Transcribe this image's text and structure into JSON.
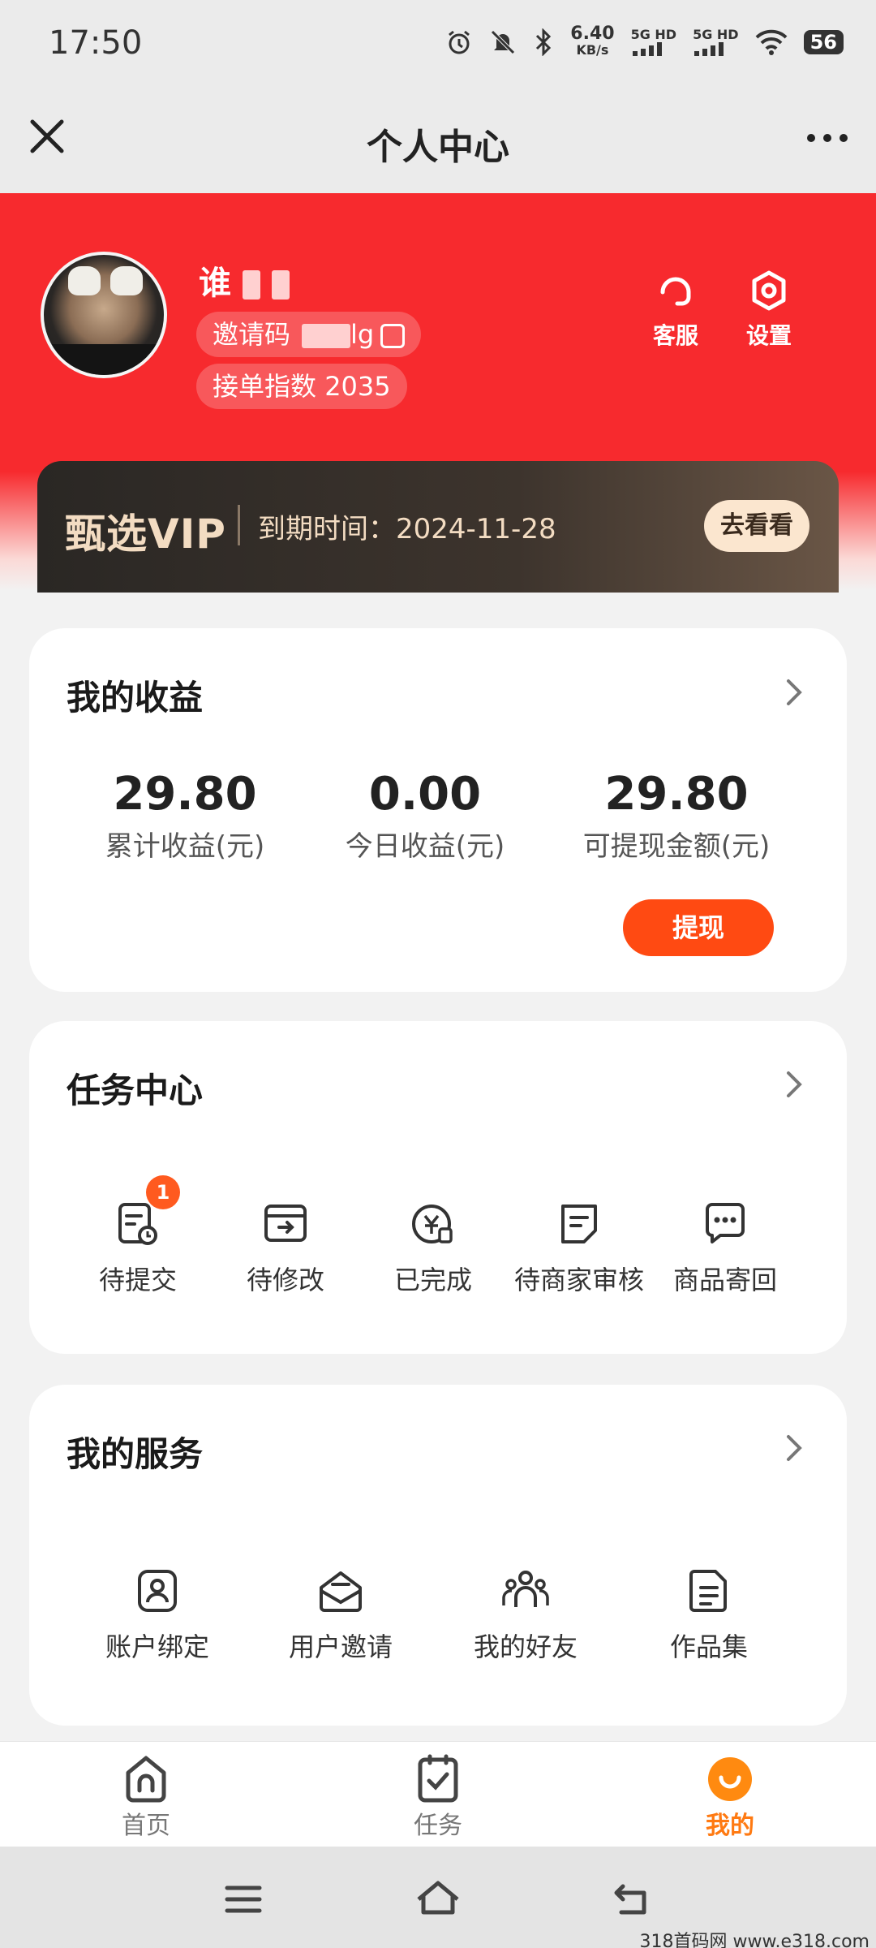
{
  "status_bar": {
    "time": "17:50",
    "net_speed_value": "6.40",
    "net_speed_unit": "KB/s",
    "sim1": "5G HD",
    "sim2": "5G HD",
    "battery": "56"
  },
  "header": {
    "title": "个人中心"
  },
  "profile": {
    "name": "谁",
    "invite_label": "邀请码",
    "invite_tail": "lg",
    "score_label": "接单指数",
    "score_value": "2035",
    "customer_service_label": "客服",
    "settings_label": "设置"
  },
  "vip": {
    "name": "甄选VIP",
    "expiry_label": "到期时间：",
    "expiry_date": "2024-11-28",
    "button_label": "去看看"
  },
  "earnings": {
    "title": "我的收益",
    "stats": [
      {
        "value": "29.80",
        "label": "累计收益(元)"
      },
      {
        "value": "0.00",
        "label": "今日收益(元)"
      },
      {
        "value": "29.80",
        "label": "可提现金额(元)"
      }
    ],
    "withdraw_label": "提现"
  },
  "tasks": {
    "title": "任务中心",
    "items": [
      {
        "label": "待提交",
        "icon": "pending-submit-icon",
        "badge": "1"
      },
      {
        "label": "待修改",
        "icon": "pending-edit-icon"
      },
      {
        "label": "已完成",
        "icon": "completed-icon"
      },
      {
        "label": "待商家审核",
        "icon": "merchant-review-icon"
      },
      {
        "label": "商品寄回",
        "icon": "return-goods-icon"
      }
    ]
  },
  "services": {
    "title": "我的服务",
    "items": [
      {
        "label": "账户绑定",
        "icon": "account-bind-icon"
      },
      {
        "label": "用户邀请",
        "icon": "user-invite-icon"
      },
      {
        "label": "我的好友",
        "icon": "friends-icon"
      },
      {
        "label": "作品集",
        "icon": "portfolio-icon"
      }
    ]
  },
  "bottom_nav": {
    "items": [
      {
        "label": "首页",
        "icon": "home-icon"
      },
      {
        "label": "任务",
        "icon": "task-icon"
      },
      {
        "label": "我的",
        "icon": "profile-icon",
        "active": true
      }
    ],
    "active_color": "#ff7a12"
  },
  "watermark": "318首码网 www.e318.com",
  "colors": {
    "header_red": "#f72a2e",
    "accent_orange": "#ff4a12",
    "vip_gold": "#f3dcc2"
  }
}
